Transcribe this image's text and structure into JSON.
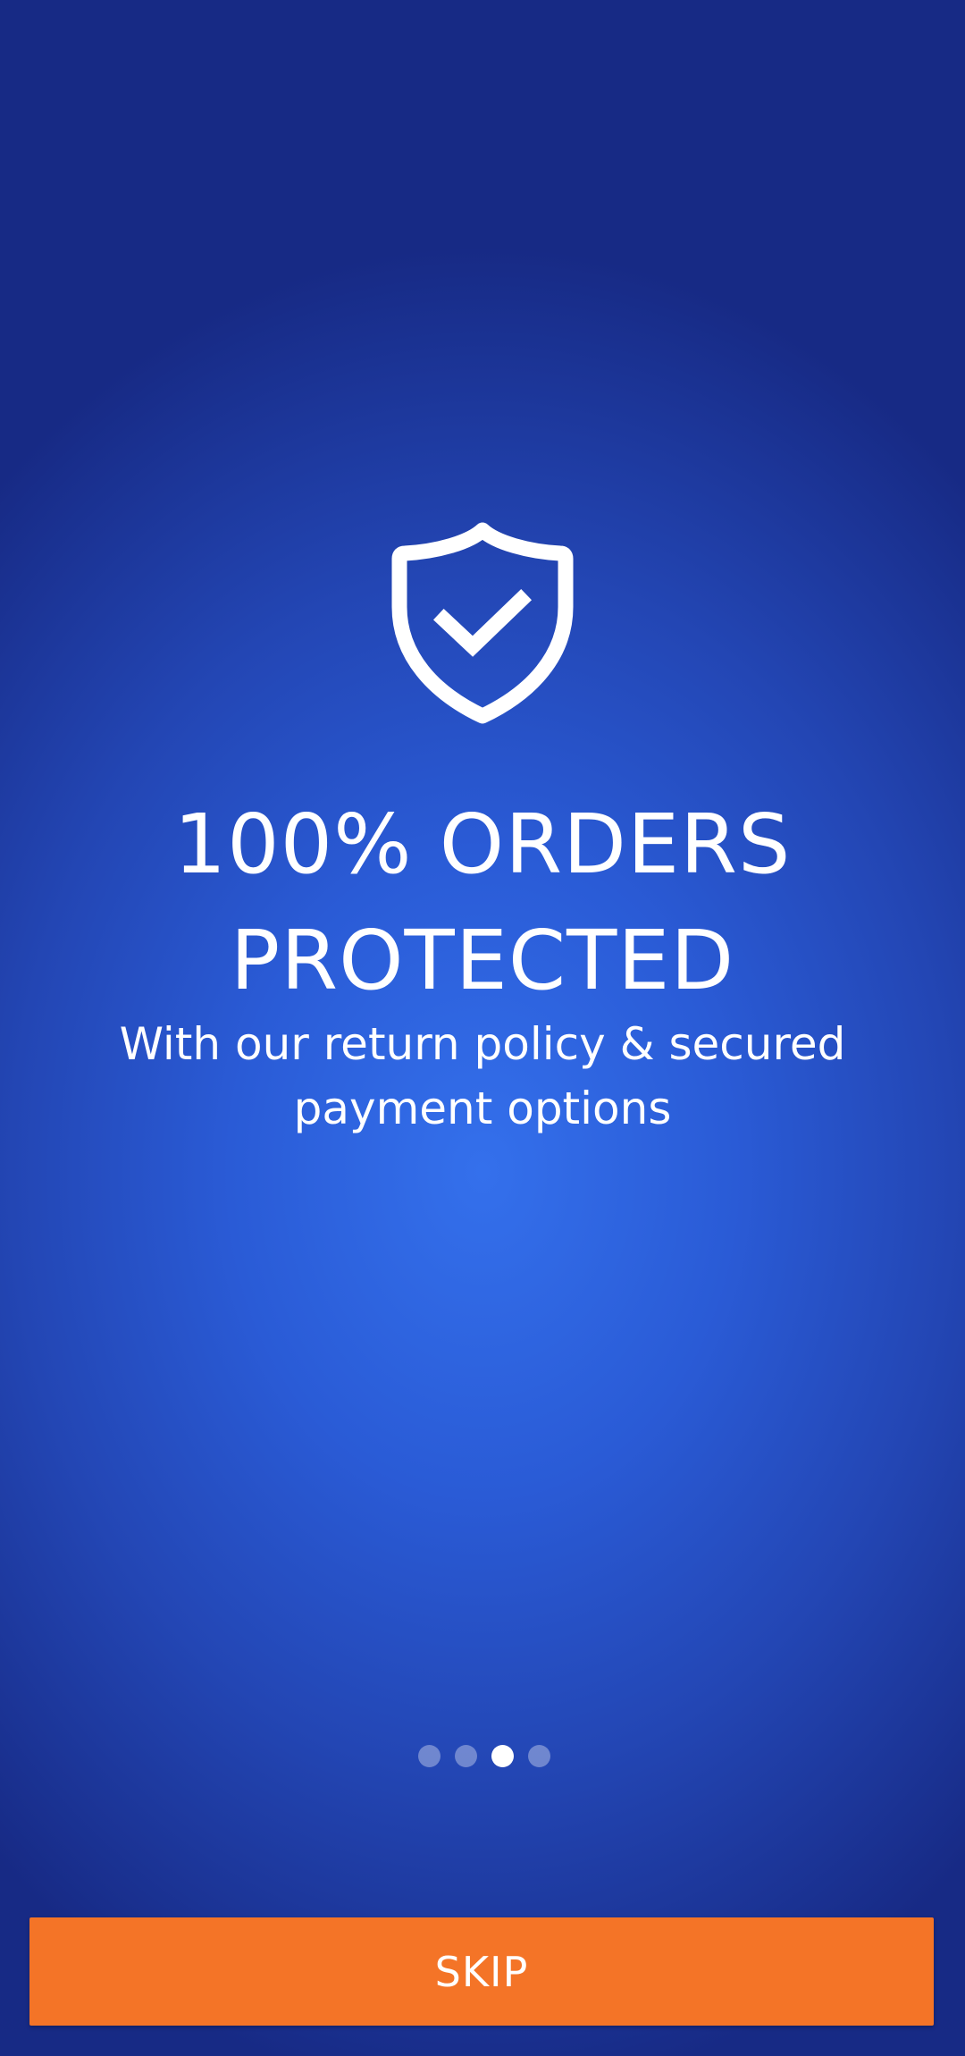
{
  "onboarding": {
    "icon": "shield-check-icon",
    "title_line1": "100% ORDERS",
    "title_line2": "PROTECTED",
    "subtitle_line1": "With our return policy & secured",
    "subtitle_line2": "payment options",
    "pager": {
      "total": 4,
      "active_index": 2
    },
    "skip_label": "SKIP"
  },
  "colors": {
    "background_center": "#3470ec",
    "background_edge": "#172a85",
    "accent_button": "#f47427",
    "text": "#ffffff",
    "dot_inactive": "rgba(255,255,255,0.35)",
    "dot_active": "#ffffff"
  }
}
